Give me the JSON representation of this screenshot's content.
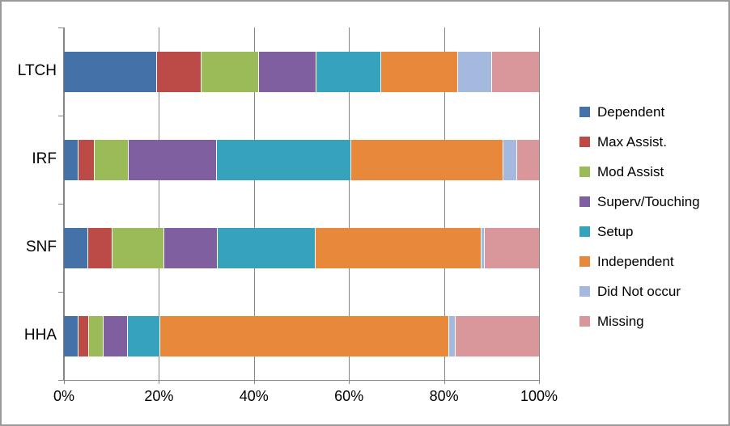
{
  "chart_data": {
    "type": "bar",
    "orientation": "horizontal",
    "stacked": true,
    "normalized_percent": true,
    "title": "",
    "subtitle": "",
    "xlabel": "",
    "ylabel": "",
    "xlim": [
      0,
      100
    ],
    "xticks": [
      0,
      20,
      40,
      60,
      80,
      100
    ],
    "xticklabels": [
      "0%",
      "20%",
      "40%",
      "60%",
      "80%",
      "100%"
    ],
    "grid": true,
    "grid_axis": "x",
    "legend_position": "right",
    "categories": [
      "LTCH",
      "IRF",
      "SNF",
      "HHA"
    ],
    "series": [
      {
        "name": "Dependent",
        "color": "#4472a8",
        "values": [
          19.6,
          3.0,
          5.1,
          3.1
        ]
      },
      {
        "name": "Max Assist.",
        "color": "#bc4b48",
        "values": [
          9.4,
          3.4,
          5.1,
          2.2
        ]
      },
      {
        "name": "Mod Assist",
        "color": "#9bbb59",
        "values": [
          12.0,
          7.2,
          11.0,
          3.1
        ]
      },
      {
        "name": "Superv/Touching",
        "color": "#7f5fa0",
        "values": [
          12.1,
          18.6,
          11.2,
          5.0
        ]
      },
      {
        "name": "Setup",
        "color": "#37a2bc",
        "values": [
          13.6,
          28.3,
          20.6,
          6.9
        ]
      },
      {
        "name": "Independent",
        "color": "#e8883a",
        "values": [
          16.2,
          32.0,
          34.9,
          60.8
        ]
      },
      {
        "name": "Did Not occur",
        "color": "#a4b9dd",
        "values": [
          7.3,
          2.9,
          0.7,
          1.4
        ]
      },
      {
        "name": "Missing",
        "color": "#d9979c",
        "values": [
          9.8,
          4.6,
          11.4,
          17.5
        ]
      }
    ]
  },
  "axis": {
    "x_tick_labels": [
      "0%",
      "20%",
      "40%",
      "60%",
      "80%",
      "100%"
    ],
    "y_tick_labels": [
      "LTCH",
      "IRF",
      "SNF",
      "HHA"
    ]
  },
  "legend": {
    "items": [
      {
        "label": "Dependent",
        "color": "#4472a8"
      },
      {
        "label": "Max Assist.",
        "color": "#bc4b48"
      },
      {
        "label": "Mod Assist",
        "color": "#9bbb59"
      },
      {
        "label": "Superv/Touching",
        "color": "#7f5fa0"
      },
      {
        "label": "Setup",
        "color": "#37a2bc"
      },
      {
        "label": "Independent",
        "color": "#e8883a"
      },
      {
        "label": "Did Not occur",
        "color": "#a4b9dd"
      },
      {
        "label": "Missing",
        "color": "#d9979c"
      }
    ]
  },
  "colors": {
    "plot_background": "#ffffff",
    "frame_border": "#9a9a9a",
    "gridline": "#868686",
    "axis_text": "#000000",
    "segment_gap": "#ffffff"
  }
}
